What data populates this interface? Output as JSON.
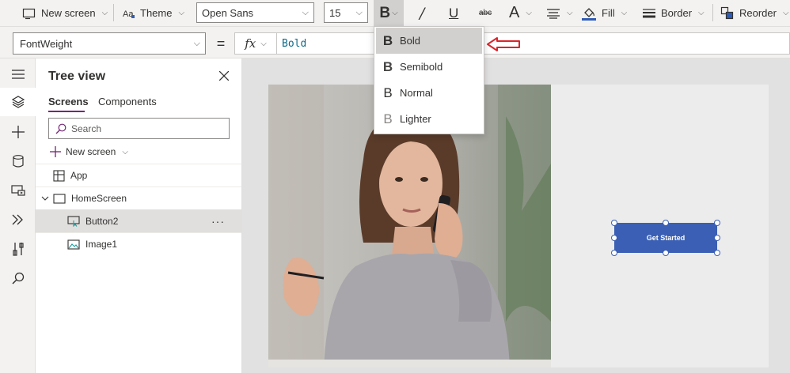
{
  "toolbar": {
    "new_screen_label": "New screen",
    "theme_label": "Theme",
    "font_family_value": "Open Sans",
    "font_size_value": "15",
    "fill_label": "Fill",
    "border_label": "Border",
    "reorder_label": "Reorder",
    "fill_color": "#2f5cb5"
  },
  "formula_bar": {
    "property_value": "FontWeight",
    "equals": "=",
    "fx_label": "fx",
    "formula_value": "Bold"
  },
  "tree_view": {
    "title": "Tree view",
    "tabs": {
      "screens": "Screens",
      "components": "Components"
    },
    "search_placeholder": "Search",
    "new_screen_label": "New screen",
    "items": [
      {
        "label": "App"
      },
      {
        "label": "HomeScreen"
      },
      {
        "label": "Button2",
        "more": "···"
      },
      {
        "label": "Image1"
      }
    ]
  },
  "font_weight_dropdown": {
    "items": [
      {
        "label": "Bold"
      },
      {
        "label": "Semibold"
      },
      {
        "label": "Normal"
      },
      {
        "label": "Lighter"
      }
    ]
  },
  "canvas": {
    "button_label": "Get Started",
    "accent_color": "#3a5fb4"
  }
}
